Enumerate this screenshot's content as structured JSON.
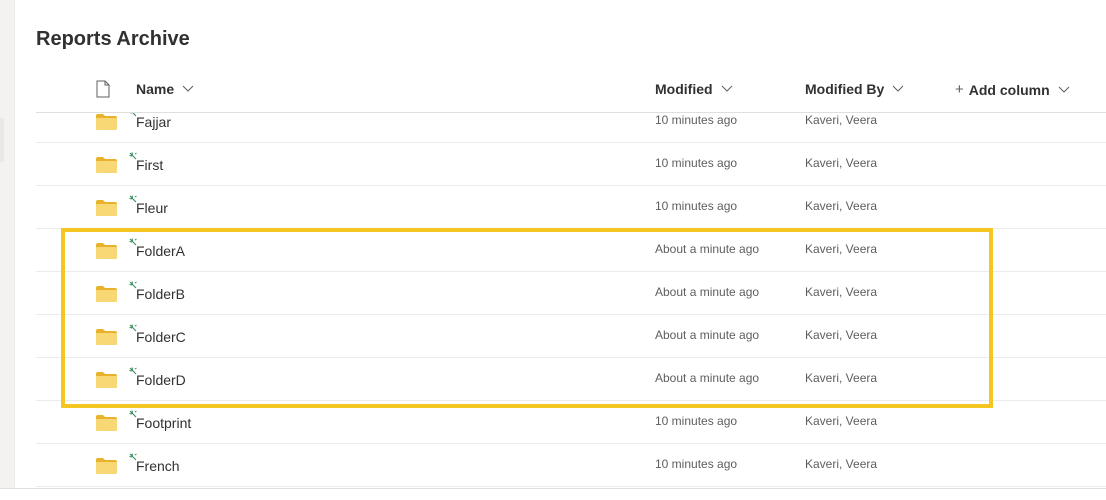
{
  "library": {
    "title": "Reports Archive"
  },
  "columns": {
    "file_type_icon": "document-icon",
    "name": "Name",
    "modified": "Modified",
    "modified_by": "Modified By",
    "add_column": "Add column"
  },
  "rows": [
    {
      "name": "Fajjar",
      "modified": "10 minutes ago",
      "modified_by": "Kaveri, Veera",
      "icon": "folder-icon",
      "new": true
    },
    {
      "name": "First",
      "modified": "10 minutes ago",
      "modified_by": "Kaveri, Veera",
      "icon": "folder-icon",
      "new": true
    },
    {
      "name": "Fleur",
      "modified": "10 minutes ago",
      "modified_by": "Kaveri, Veera",
      "icon": "folder-icon",
      "new": true
    },
    {
      "name": "FolderA",
      "modified": "About a minute ago",
      "modified_by": "Kaveri, Veera",
      "icon": "folder-icon",
      "new": true
    },
    {
      "name": "FolderB",
      "modified": "About a minute ago",
      "modified_by": "Kaveri, Veera",
      "icon": "folder-icon",
      "new": true
    },
    {
      "name": "FolderC",
      "modified": "About a minute ago",
      "modified_by": "Kaveri, Veera",
      "icon": "folder-icon",
      "new": true
    },
    {
      "name": "FolderD",
      "modified": "About a minute ago",
      "modified_by": "Kaveri, Veera",
      "icon": "folder-icon",
      "new": true
    },
    {
      "name": "Footprint",
      "modified": "10 minutes ago",
      "modified_by": "Kaveri, Veera",
      "icon": "folder-icon",
      "new": true
    },
    {
      "name": "French",
      "modified": "10 minutes ago",
      "modified_by": "Kaveri, Veera",
      "icon": "folder-icon",
      "new": true
    }
  ],
  "colors": {
    "highlight": "#f3c622",
    "folder": "#f8d775",
    "folder_tab": "#e8b22c",
    "new_mark": "#2e8b57"
  }
}
